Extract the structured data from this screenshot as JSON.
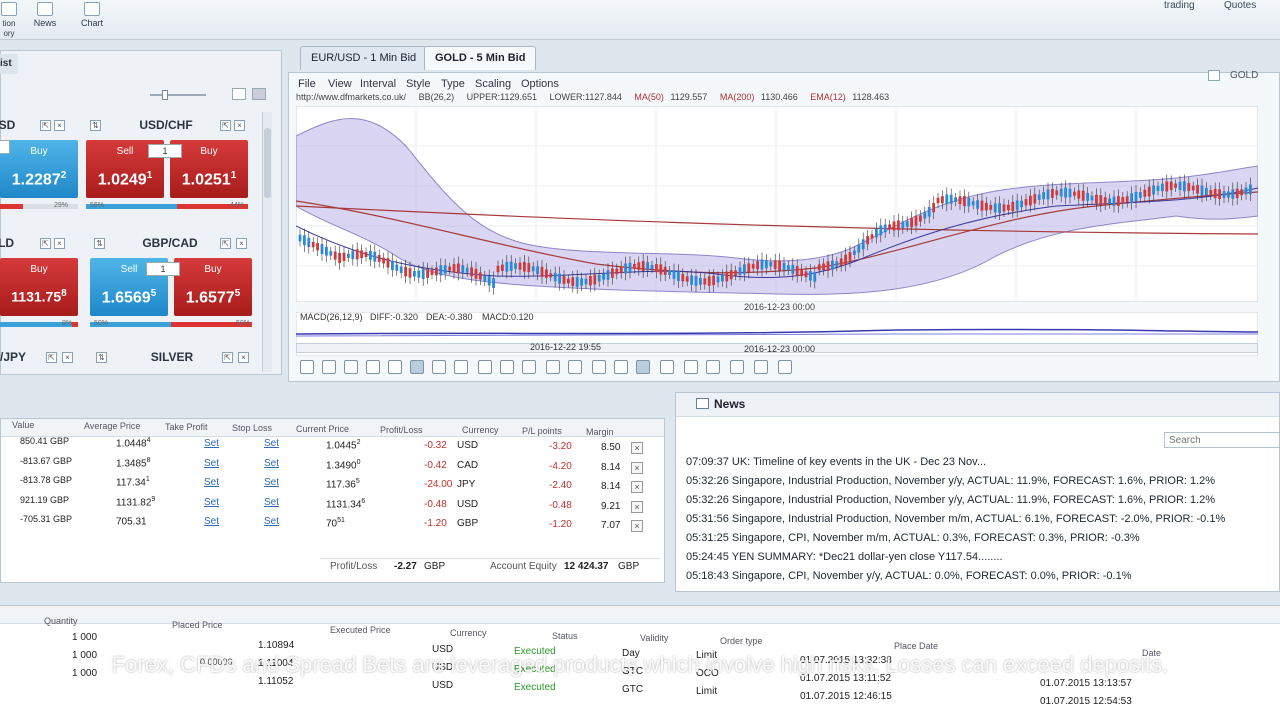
{
  "topbar": {
    "buttons": [
      {
        "label": "tion\nory"
      },
      {
        "label": "News"
      },
      {
        "label": "Chart"
      }
    ],
    "links": [
      "trading",
      "Quotes"
    ]
  },
  "watchlist": {
    "tab_label": "ist",
    "tiles": [
      {
        "title": "USD",
        "sell_label": "",
        "buy_label": "Buy",
        "qty": "",
        "buy_price": "1.2287",
        "buy_sup": "2",
        "sell_pct": "",
        "buy_pct": "29%",
        "sell_color": "blue",
        "buy_color": "blue"
      },
      {
        "title": "USD/CHF",
        "sell_label": "Sell",
        "buy_label": "Buy",
        "qty": "1",
        "sell_price": "1.0249",
        "sell_sup": "1",
        "buy_price": "1.0251",
        "buy_sup": "1",
        "sell_pct": "56%",
        "buy_pct": "44%",
        "sell_color": "red",
        "buy_color": "red"
      },
      {
        "title": "LD",
        "buy_label": "Buy",
        "buy_price": "1131.75",
        "buy_sup": "8",
        "buy_pct": "8%",
        "buy_color": "red"
      },
      {
        "title": "GBP/CAD",
        "sell_label": "Sell",
        "buy_label": "Buy",
        "qty": "1",
        "sell_price": "1.6569",
        "sell_sup": "5",
        "buy_price": "1.6577",
        "buy_sup": "5",
        "sell_pct": "50%",
        "buy_pct": "50%",
        "sell_color": "blue",
        "buy_color": "red"
      },
      {
        "title": "/JPY"
      },
      {
        "title": "SILVER"
      }
    ]
  },
  "chart": {
    "tabs": [
      "EUR/USD - 1 Min Bid",
      "GOLD - 5 Min Bid"
    ],
    "menu": [
      "File",
      "View",
      "Interval",
      "Style",
      "Type",
      "Scaling",
      "Options"
    ],
    "symbol": "GOLD",
    "url": "http://www.dfmarkets.co.uk/",
    "indicators": [
      "BB(26,2)",
      "UPPER:1129.651",
      "LOWER:1127.844",
      "MA(50)",
      "1129.557",
      "MA(200)",
      "1130.466",
      "EMA(12)",
      "1128.463"
    ],
    "date_label_1": "2016-12-23 00:00",
    "macd_label": "MACD(26,12,9)",
    "macd_diff": "DIFF:-0.320",
    "macd_dea": "DEA:-0.380",
    "macd_val": "MACD:0.120",
    "date_label_2": "2016-12-22 19:55",
    "date_label_3": "2016-12-23 00:00"
  },
  "positions": {
    "headers": [
      "Value",
      "Average Price",
      "Take Profit",
      "Stop Loss",
      "Current Price",
      "Profit/Loss",
      "Currency",
      "P/L points",
      "Margin"
    ],
    "rows": [
      {
        "value": "850.41 GBP",
        "avg": "1.0448",
        "avg_sup": "4",
        "tp": "Set",
        "sl": "Set",
        "cur": "1.0445",
        "cur_sup": "2",
        "pl": "-0.32",
        "ccy": "USD",
        "pts": "-3.20",
        "margin": "8.50"
      },
      {
        "value": "-813.67 GBP",
        "avg": "1.3485",
        "avg_sup": "8",
        "tp": "Set",
        "sl": "Set",
        "cur": "1.3490",
        "cur_sup": "0",
        "pl": "-0.42",
        "ccy": "CAD",
        "pts": "-4.20",
        "margin": "8.14"
      },
      {
        "value": "-813.78 GBP",
        "avg": "117.34",
        "avg_sup": "1",
        "tp": "Set",
        "sl": "Set",
        "cur": "117.36",
        "cur_sup": "5",
        "pl": "-24.00",
        "ccy": "JPY",
        "pts": "-2.40",
        "margin": "8.14"
      },
      {
        "value": "921.19 GBP",
        "avg": "1131.82",
        "avg_sup": "9",
        "tp": "Set",
        "sl": "Set",
        "cur": "1131.34",
        "cur_sup": "6",
        "pl": "-0.48",
        "ccy": "USD",
        "pts": "-0.48",
        "margin": "9.21"
      },
      {
        "value": "-705.31 GBP",
        "avg": "705.31",
        "avg_sup": "",
        "tp": "Set",
        "sl": "Set",
        "cur": "70",
        "cur_sup": "51",
        "pl": "-1.20",
        "ccy": "GBP",
        "pts": "-1.20",
        "margin": "7.07"
      }
    ],
    "footer": {
      "pl_label": "Profit/Loss",
      "pl_value": "-2.27",
      "pl_ccy": "GBP",
      "eq_label": "Account Equity",
      "eq_value": "12 424.37",
      "eq_ccy": "GBP"
    }
  },
  "news": {
    "title": "News",
    "search_placeholder": "Search",
    "items": [
      {
        "time": "07:09:37",
        "text": "UK: Timeline of key events in the UK - Dec 23 Nov..."
      },
      {
        "time": "05:32:26",
        "text": "Singapore, Industrial Production, November y/y, ACTUAL: 11.9%, FORECAST: 1.6%, PRIOR: 1.2%"
      },
      {
        "time": "05:32:26",
        "text": "Singapore, Industrial Production, November y/y, ACTUAL: 11.9%, FORECAST: 1.6%, PRIOR: 1.2%"
      },
      {
        "time": "05:31:56",
        "text": "Singapore, Industrial Production, November m/m, ACTUAL: 6.1%, FORECAST: -2.0%, PRIOR: -0.1%"
      },
      {
        "time": "05:31:25",
        "text": "Singapore, CPI, November m/m, ACTUAL: 0.3%, FORECAST: 0.3%, PRIOR: -0.3%"
      },
      {
        "time": "05:24:45",
        "text": "YEN SUMMARY: *Dec21 dollar-yen close Y117.54........"
      },
      {
        "time": "05:18:43",
        "text": "Singapore, CPI, November y/y, ACTUAL: 0.0%, FORECAST: 0.0%, PRIOR: -0.1%"
      }
    ]
  },
  "orders": {
    "headers": [
      "Quantity",
      "Placed Price",
      "Executed Price",
      "Currency",
      "Status",
      "Validity",
      "Order type",
      "Place Date",
      "Date"
    ],
    "rows": [
      {
        "qty": "1 000",
        "placed": "",
        "exec": "1.10894",
        "ccy": "USD",
        "status": "Executed",
        "validity": "Day",
        "type": "Limit",
        "place_date": "01.07.2015 13:32:38",
        "date": ""
      },
      {
        "qty": "1 000",
        "placed": "0.00000",
        "exec": "1.11004",
        "ccy": "USD",
        "status": "Executed",
        "validity": "GTC",
        "type": "OCO",
        "place_date": "01.07.2015 13:11:52",
        "date": "01.07.2015 13:13:57"
      },
      {
        "qty": "1 000",
        "placed": "",
        "exec": "1.11052",
        "ccy": "USD",
        "status": "Executed",
        "validity": "GTC",
        "type": "Limit",
        "place_date": "01.07.2015 12:46:15",
        "date": "01.07.2015 12:54:53"
      }
    ],
    "placed_extra": "0.00000"
  },
  "disclaimer": "Forex, CFDs and Spread Bets are leveraged products which involve high risks. Losses can exceed deposits."
}
